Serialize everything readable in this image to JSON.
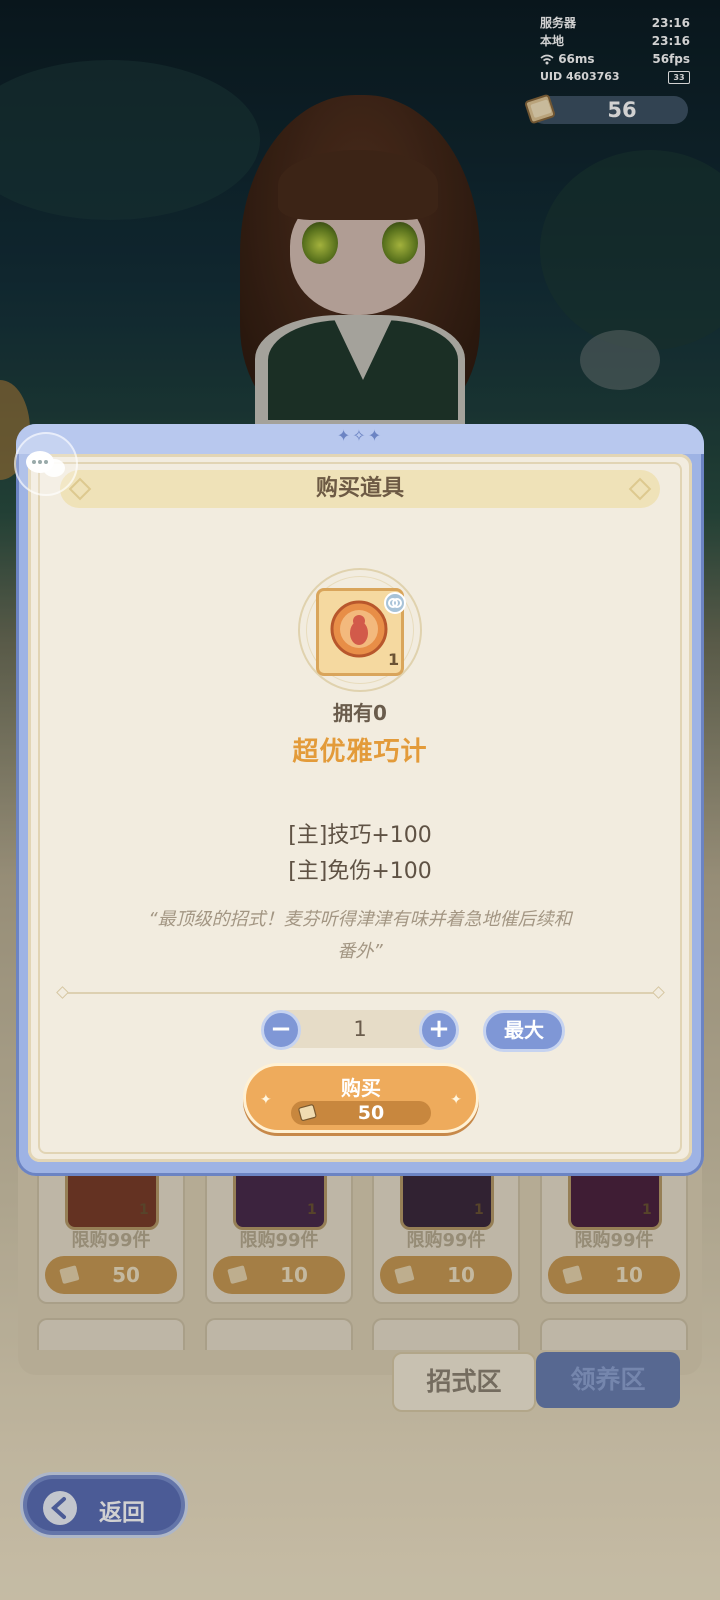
{
  "hud": {
    "server_label": "服务器",
    "server_time": "23:16",
    "local_label": "本地",
    "local_time": "23:16",
    "ping": "66ms",
    "fps": "56fps",
    "uid_label": "UID",
    "uid_value": "4603763",
    "battery_level": "33"
  },
  "currency": {
    "icon": "scroll-book-icon",
    "amount": "56"
  },
  "modal": {
    "title": "购买道具",
    "item": {
      "icon": "skill-scroll-icon",
      "count_badge": "1",
      "owned_text": "拥有0",
      "name": "超优雅巧计",
      "stats": [
        "[主]技巧+100",
        "[主]免伤+100"
      ],
      "flavor_line1": "“最顶级的招式！麦芬听得津津有味并着急地催后续和",
      "flavor_line2": "番外”"
    },
    "quantity": {
      "value": "1",
      "minus_label": "−",
      "plus_label": "+",
      "max_label": "最大"
    },
    "buy": {
      "label": "购买",
      "price": "50",
      "price_icon": "scroll-book-icon"
    }
  },
  "shop": {
    "cards": [
      {
        "limit": "限购99件",
        "price": "50",
        "count": "1",
        "color": "#b25a3a"
      },
      {
        "limit": "限购99件",
        "price": "10",
        "count": "1",
        "color": "#8a4d8c"
      },
      {
        "limit": "限购99件",
        "price": "10",
        "count": "1",
        "color": "#6b4a6c"
      },
      {
        "limit": "限购99件",
        "price": "10",
        "count": "1",
        "color": "#8d3f6c"
      }
    ],
    "tabs": {
      "skill": "招式区",
      "care": "领养区"
    }
  },
  "back": {
    "label": "返回"
  },
  "colors": {
    "accent_orange": "#eeab5c",
    "accent_blue": "#7f97d6",
    "item_name": "#e39b3a"
  }
}
